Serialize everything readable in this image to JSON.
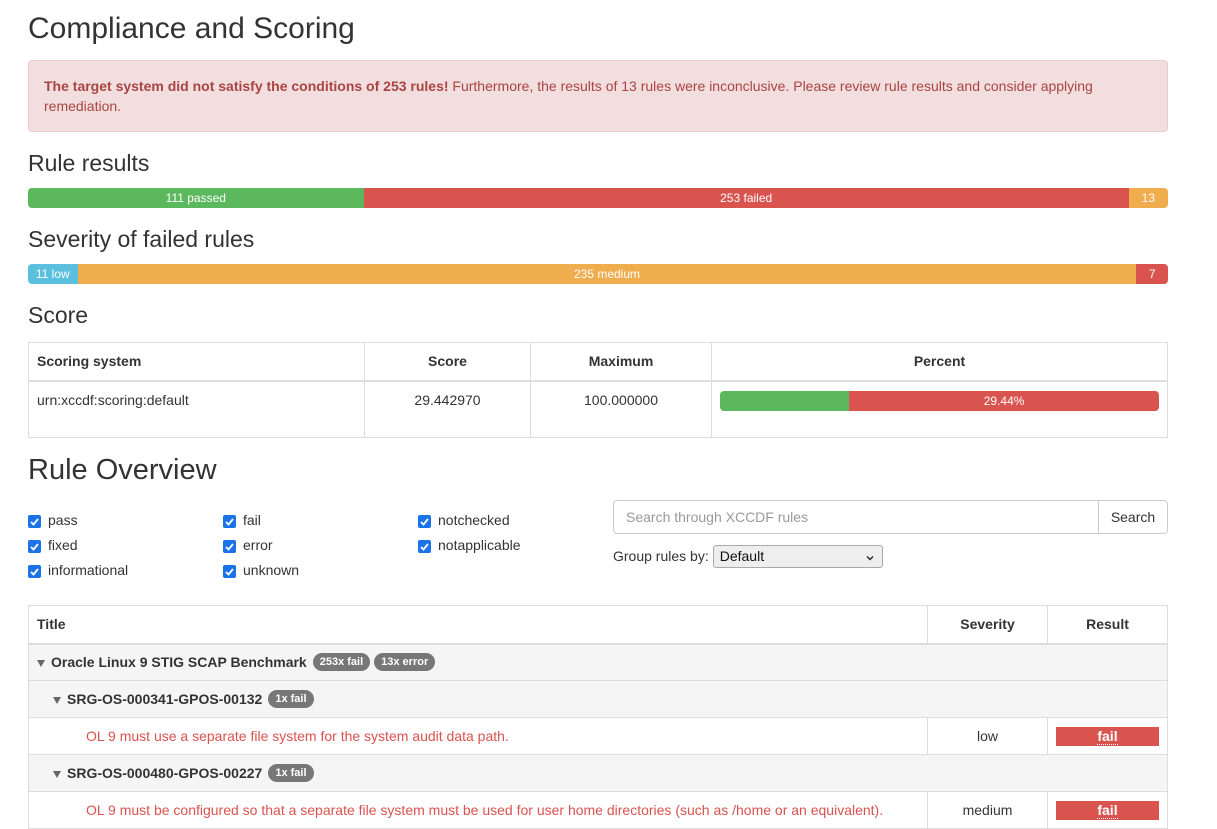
{
  "compliance": {
    "title": "Compliance and Scoring",
    "alert_strong": "The target system did not satisfy the conditions of 253 rules!",
    "alert_text": " Furthermore, the results of 13 rules were inconclusive. Please review rule results and consider applying remediation."
  },
  "rule_results": {
    "title": "Rule results",
    "passed_label": "111 passed",
    "failed_label": "253 failed",
    "other_label": "13",
    "passed": 111,
    "failed": 253,
    "other": 13,
    "colors": {
      "passed": "#5cb85c",
      "failed": "#d9534f",
      "other": "#f0ad4e"
    }
  },
  "severity": {
    "title": "Severity of failed rules",
    "low_label": "11 low",
    "medium_label": "235 medium",
    "high_label": "7",
    "low": 11,
    "medium": 235,
    "high": 7,
    "colors": {
      "low": "#5bc0de",
      "medium": "#f0ad4e",
      "high": "#d9534f"
    }
  },
  "score": {
    "title": "Score",
    "headers": {
      "system": "Scoring system",
      "score": "Score",
      "maximum": "Maximum",
      "percent": "Percent"
    },
    "row": {
      "system": "urn:xccdf:scoring:default",
      "score": "29.442970",
      "maximum": "100.000000",
      "percent_label": "29.44%"
    },
    "percent_value": 29.44
  },
  "overview": {
    "title": "Rule Overview",
    "filters": {
      "pass": "pass",
      "fixed": "fixed",
      "informational": "informational",
      "fail": "fail",
      "error": "error",
      "unknown": "unknown",
      "notchecked": "notchecked",
      "notapplicable": "notapplicable"
    },
    "search_placeholder": "Search through XCCDF rules",
    "search_button": "Search",
    "group_by_label": "Group rules by:",
    "group_by_value": "Default"
  },
  "rules_table": {
    "headers": {
      "title": "Title",
      "severity": "Severity",
      "result": "Result"
    },
    "benchmark": {
      "title": "Oracle Linux 9 STIG SCAP Benchmark",
      "badge_fail": "253x fail",
      "badge_error": "13x error"
    },
    "groups": [
      {
        "title": "SRG-OS-000341-GPOS-00132",
        "badge": "1x fail",
        "rule": {
          "title": "OL 9 must use a separate file system for the system audit data path.",
          "severity": "low",
          "result": "fail"
        }
      },
      {
        "title": "SRG-OS-000480-GPOS-00227",
        "badge": "1x fail",
        "rule": {
          "title": "OL 9 must be configured so that a separate file system must be used for user home directories (such as /home or an equivalent).",
          "severity": "medium",
          "result": "fail"
        }
      }
    ]
  }
}
